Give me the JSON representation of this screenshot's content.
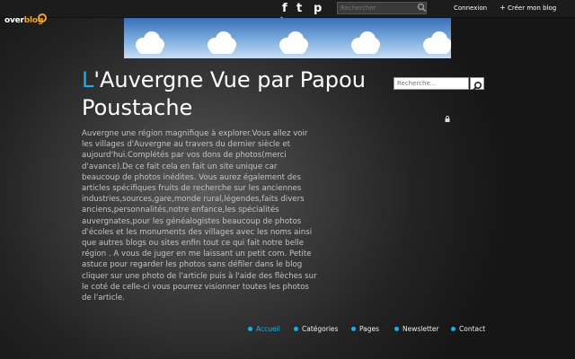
{
  "topbar": {
    "logo": {
      "text_a": "over",
      "text_b": "blog"
    },
    "social": {
      "facebook": "f",
      "twitter": "t",
      "pinterest": "p"
    },
    "search_placeholder": "Rechercher",
    "login_label": "Connexion",
    "create_plus": "+",
    "create_label": "Créer mon blog"
  },
  "blog": {
    "title_first_letter": "L",
    "title_rest": "'Auvergne Vue par Papou Poustache",
    "description": "Auvergne une région magnifique à explorer.Vous allez voir les villages d'Auvergne au travers du dernier siècle et aujourd'hui.Complétés par vos dons de photos(merci d'avance).De ce fait cela en fait un site unique car beaucoup de photos inédites. Vous aurez également des articles spécifiques fruits de recherche sur les anciennes industries,sources,gare,monde rural,légendes,faits divers anciens,personnalités,notre enfance,les spécialités auvergnates,pour les généalogistes beaucoup de photos d'écoles et les monuments des villages avec les noms ainsi que autres blogs ou sites enfin tout ce qui fait notre belle région . A vous de juger en me laissant un petit com. Petite astuce pour regarder les photos sans défiler dans le blog cliquer sur une photo de l'article puis à l'aide des flèches sur le coté de celle-ci vous pourrez visionner toutes les photos de l'article."
  },
  "sidebar": {
    "search_placeholder": "Recherche..."
  },
  "nav": {
    "items": [
      {
        "label": "Accueil"
      },
      {
        "label": "Catégories"
      },
      {
        "label": "Pages"
      },
      {
        "label": "Newsletter"
      },
      {
        "label": "Contact"
      }
    ]
  },
  "colors": {
    "accent": "#1ab0e8",
    "logo": "#e8a33c",
    "sky": "#7eaee0"
  },
  "icons": [
    "facebook-icon",
    "twitter-icon",
    "pinterest-icon",
    "search-icon",
    "chevron-up-icon",
    "lock-icon",
    "cloud-icon"
  ]
}
